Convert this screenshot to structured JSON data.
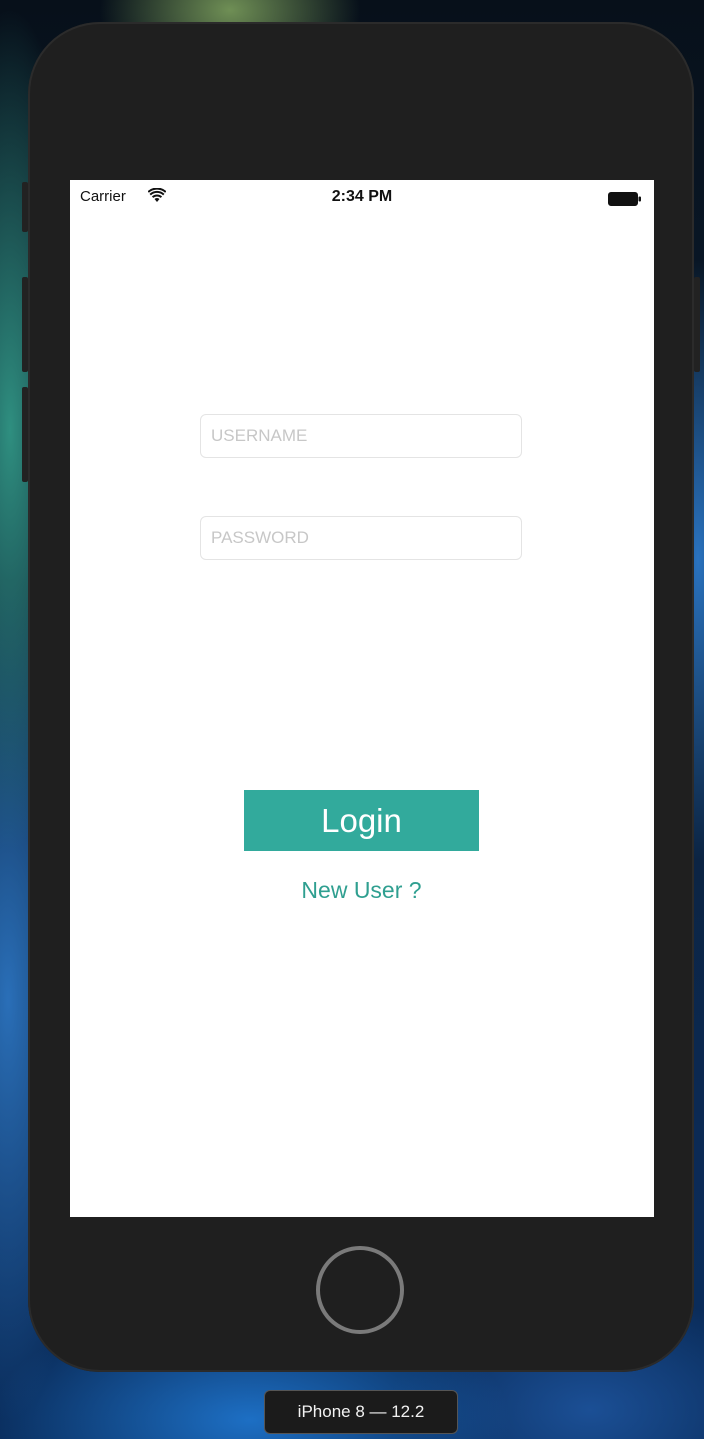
{
  "status_bar": {
    "carrier": "Carrier",
    "time": "2:34 PM",
    "wifi_icon": "wifi-icon",
    "battery_icon": "battery-icon"
  },
  "login_form": {
    "username": {
      "placeholder": "USERNAME",
      "value": ""
    },
    "password": {
      "placeholder": "PASSWORD",
      "value": ""
    },
    "login_label": "Login",
    "new_user_label": "New User ?"
  },
  "simulator": {
    "device_label": "iPhone 8 — 12.2",
    "home_button_icon": "home-button-circle"
  },
  "colors": {
    "accent": "#32aa9c",
    "link": "#2f9f90",
    "device_body": "#1f1f1f",
    "screen_bg": "#ffffff"
  }
}
